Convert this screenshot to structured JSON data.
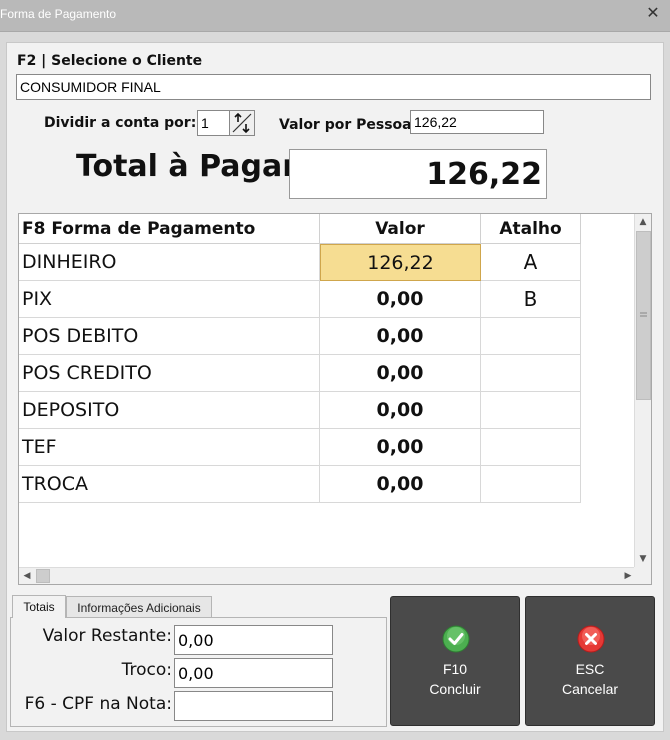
{
  "window": {
    "title": "Forma de Pagamento"
  },
  "cliente": {
    "label": "F2 | Selecione o Cliente",
    "value": "CONSUMIDOR FINAL"
  },
  "dividir": {
    "label": "Dividir a conta por:",
    "value": "1"
  },
  "valor_pessoa": {
    "label": "Valor por Pessoa:",
    "value": "126,22"
  },
  "total": {
    "label": "Total à Pagar:",
    "value": "126,22"
  },
  "grid": {
    "headers": [
      "F8 Forma de Pagamento",
      "Valor",
      "Atalho"
    ],
    "rows": [
      {
        "name": "DINHEIRO",
        "value": "126,22",
        "key": "A"
      },
      {
        "name": "PIX",
        "value": "0,00",
        "key": "B"
      },
      {
        "name": "POS DEBITO",
        "value": "0,00",
        "key": ""
      },
      {
        "name": "POS CREDITO",
        "value": "0,00",
        "key": ""
      },
      {
        "name": "DEPOSITO",
        "value": "0,00",
        "key": ""
      },
      {
        "name": "TEF",
        "value": "0,00",
        "key": ""
      },
      {
        "name": "TROCA",
        "value": "0,00",
        "key": ""
      }
    ],
    "selected_row": 0
  },
  "tabs": {
    "totais": "Totais",
    "info": "Informações Adicionais"
  },
  "totais": {
    "restante_label": "Valor Restante:",
    "restante_value": "0,00",
    "troco_label": "Troco:",
    "troco_value": "0,00",
    "cpf_label": "F6 - CPF na Nota:",
    "cpf_value": ""
  },
  "buttons": {
    "concluir": {
      "key": "F10",
      "label": "Concluir"
    },
    "cancelar": {
      "key": "ESC",
      "label": "Cancelar"
    }
  },
  "colors": {
    "selected_cell": "#f6dd92",
    "button_bg": "#4a4a4a",
    "ok_icon": "#4caf50",
    "cancel_icon": "#e53935"
  },
  "icons": {
    "close": "close-icon",
    "spinner": "spinner-arrows-icon",
    "ok": "check-circle-icon",
    "cancel": "x-circle-icon"
  }
}
